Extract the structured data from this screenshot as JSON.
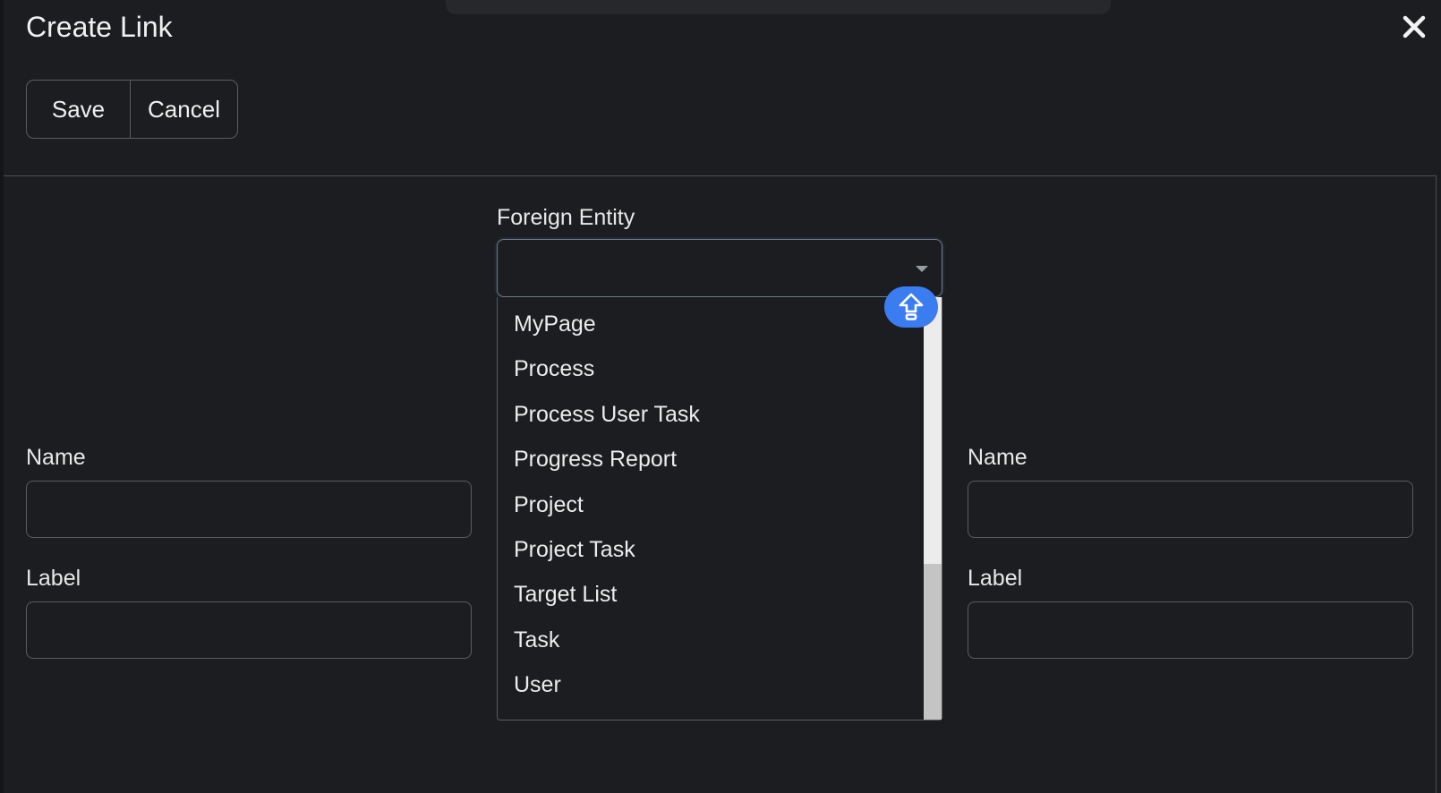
{
  "dialog": {
    "title": "Create Link",
    "close_icon": "close-icon"
  },
  "toolbar": {
    "save_label": "Save",
    "cancel_label": "Cancel"
  },
  "foreign_entity": {
    "label": "Foreign Entity",
    "value": "",
    "options": [
      "MyPage",
      "Process",
      "Process User Task",
      "Progress Report",
      "Project",
      "Project Task",
      "Target List",
      "Task",
      "User"
    ]
  },
  "left": {
    "name_label": "Name",
    "name_value": "",
    "label_label": "Label",
    "label_value": ""
  },
  "right": {
    "name_label": "Name",
    "name_value": "",
    "label_label": "Label",
    "label_value": ""
  },
  "colors": {
    "background": "#1b1d20",
    "accent": "#3b7cf0",
    "border": "#5a5d60"
  }
}
